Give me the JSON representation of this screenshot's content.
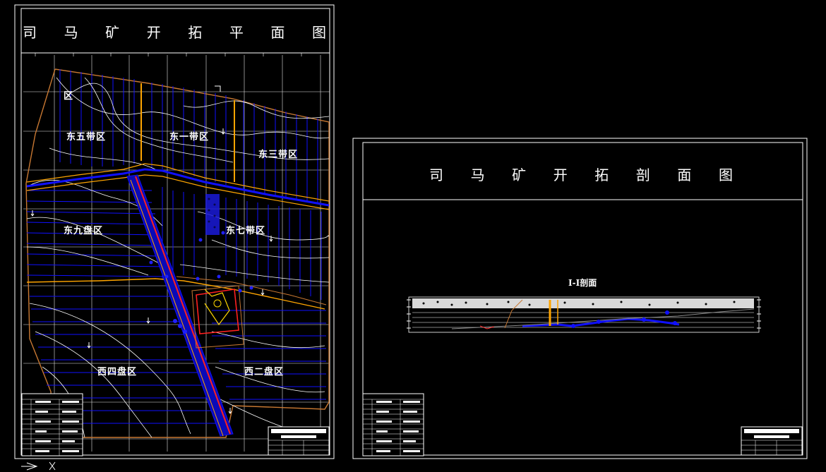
{
  "plan_sheet": {
    "title": "司马矿开拓平面图",
    "title_chars": [
      "司",
      "马",
      "矿",
      "开",
      "拓",
      "平",
      "面",
      "图"
    ],
    "zones": {
      "zone_top_left": "区",
      "east_five": "东五带区",
      "east_one": "东一带区",
      "east_three": "东三带区",
      "east_nine": "东九盘区",
      "east_seven": "东七带区",
      "west_four": "西四盘区",
      "west_two": "西二盘区"
    }
  },
  "section_sheet": {
    "title": "司马矿开拓剖面图",
    "title_chars": [
      "司",
      "马",
      "矿",
      "开",
      "拓",
      "剖",
      "面",
      "图"
    ],
    "section_label": "I-I剖面"
  },
  "colors": {
    "background": "#000000",
    "frame": "#ffffff",
    "grid": "#ffffff",
    "coal_seam": "#0000ff",
    "roadway_red": "#ff0000",
    "roadway_orange": "#ffa500",
    "boundary_brown": "#c87832"
  },
  "icons": {
    "ucs": "ucs-axis-icon"
  }
}
